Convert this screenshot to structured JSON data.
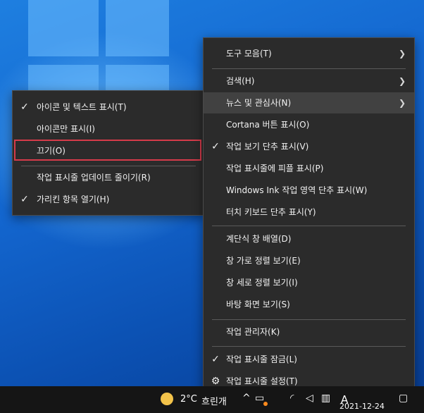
{
  "submenu": {
    "items": [
      {
        "label": "아이콘 및 텍스트 표시(T)",
        "checked": true
      },
      {
        "label": "아이콘만 표시(I)",
        "checked": false
      },
      {
        "label": "끄기(O)",
        "checked": false,
        "highlighted": true
      },
      {
        "label": "작업 표시줄 업데이트 줄이기(R)",
        "checked": false
      },
      {
        "label": "가리킨 항목 열기(H)",
        "checked": true
      }
    ]
  },
  "context_menu": {
    "items": [
      {
        "label": "도구 모음(T)",
        "submenu": true
      },
      {
        "label": "검색(H)",
        "submenu": true
      },
      {
        "label": "뉴스 및 관심사(N)",
        "submenu": true,
        "active": true
      },
      {
        "label": "Cortana 버튼 표시(O)"
      },
      {
        "label": "작업 보기 단추 표시(V)",
        "checked": true
      },
      {
        "label": "작업 표시줄에 피플 표시(P)"
      },
      {
        "label": "Windows Ink 작업 영역 단추 표시(W)"
      },
      {
        "label": "터치 키보드 단추 표시(Y)"
      },
      {
        "label": "계단식 창 배열(D)"
      },
      {
        "label": "창 가로 정렬 보기(E)"
      },
      {
        "label": "창 세로 정렬 보기(I)"
      },
      {
        "label": "바탕 화면 보기(S)"
      },
      {
        "label": "작업 관리자(K)"
      },
      {
        "label": "작업 표시줄 잠금(L)",
        "checked": true
      },
      {
        "label": "작업 표시줄 설정(T)",
        "icon": "gear-icon"
      }
    ]
  },
  "taskbar": {
    "weather_temp": "2°C",
    "weather_desc": "흐린개",
    "ime": "A",
    "date": "2021-12-24"
  },
  "colors": {
    "highlight_border": "#d63b4a",
    "menu_bg": "#2b2b2b",
    "hover_bg": "#414141"
  }
}
